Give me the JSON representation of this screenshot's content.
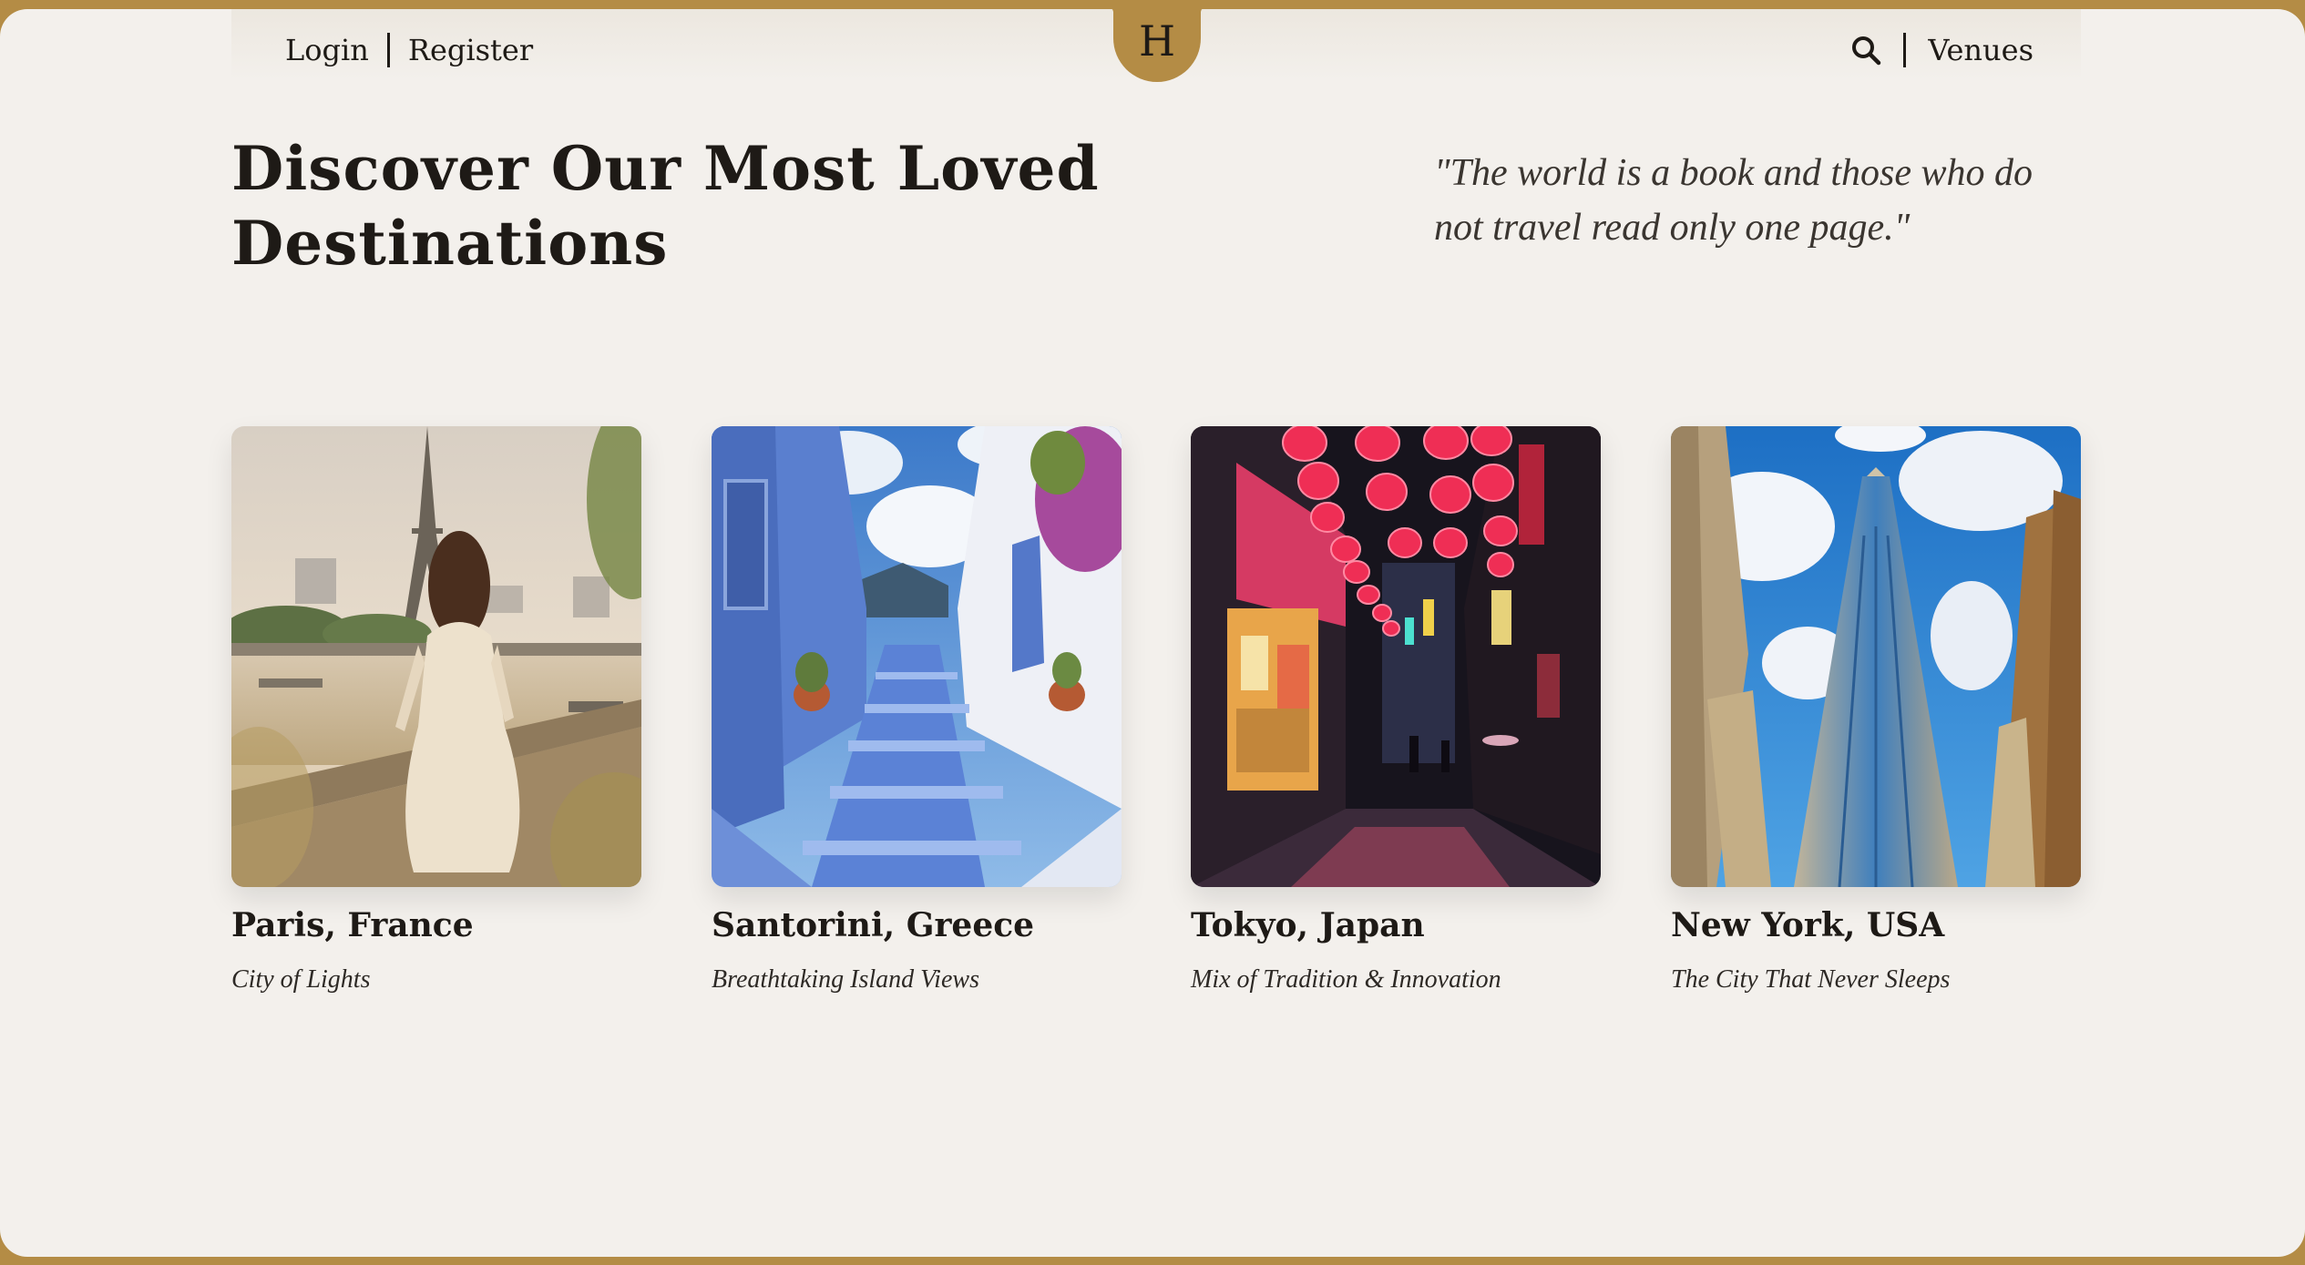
{
  "nav": {
    "login": "Login",
    "register": "Register",
    "logo_letter": "H",
    "venues": "Venues",
    "search_icon": "search-icon"
  },
  "hero": {
    "title": "Discover Our Most Loved Destinations",
    "quote": "\"The world is a book and those who do not travel read only one page.\""
  },
  "destinations": [
    {
      "title": "Paris, France",
      "subtitle": "City of Lights"
    },
    {
      "title": "Santorini, Greece",
      "subtitle": "Breathtaking Island Views"
    },
    {
      "title": "Tokyo, Japan",
      "subtitle": "Mix of Tradition & Innovation"
    },
    {
      "title": "New York, USA",
      "subtitle": "The City That Never Sleeps"
    }
  ],
  "colors": {
    "accent": "#b48c45",
    "background": "#f3f0ec",
    "text": "#1e1a16"
  }
}
